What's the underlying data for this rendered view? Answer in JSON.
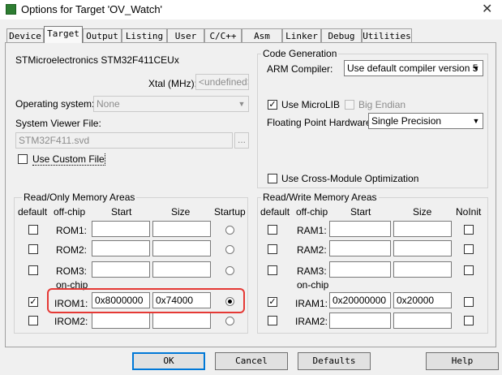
{
  "window": {
    "title": "Options for Target 'OV_Watch'",
    "close": "✕"
  },
  "tabs": [
    "Device",
    "Target",
    "Output",
    "Listing",
    "User",
    "C/C++",
    "Asm",
    "Linker",
    "Debug",
    "Utilities"
  ],
  "active_tab": "Target",
  "device": {
    "name": "STMicroelectronics STM32F411CEUx",
    "xtal_label": "Xtal (MHz):",
    "xtal_value": "<undefined>",
    "os_label": "Operating system:",
    "os_value": "None",
    "svd_label": "System Viewer File:",
    "svd_value": "STM32F411.svd",
    "browse": "...",
    "custom_file_label": "Use Custom File"
  },
  "codegen": {
    "title": "Code Generation",
    "compiler_label": "ARM Compiler:",
    "compiler_value": "Use default compiler version 5",
    "microlib_label": "Use MicroLIB",
    "big_endian_label": "Big Endian",
    "fp_label": "Floating Point Hardware:",
    "fp_value": "Single Precision",
    "cross_module_label": "Use Cross-Module Optimization"
  },
  "rom": {
    "title": "Read/Only Memory Areas",
    "headers": {
      "default": "default",
      "offchip": "off-chip",
      "start": "Start",
      "size": "Size",
      "startup": "Startup"
    },
    "onchip_label": "on-chip",
    "rows": [
      {
        "name": "ROM1:",
        "start": "",
        "size": ""
      },
      {
        "name": "ROM2:",
        "start": "",
        "size": ""
      },
      {
        "name": "ROM3:",
        "start": "",
        "size": ""
      },
      {
        "name": "IROM1:",
        "start": "0x8000000",
        "size": "0x74000"
      },
      {
        "name": "IROM2:",
        "start": "",
        "size": ""
      }
    ]
  },
  "ram": {
    "title": "Read/Write Memory Areas",
    "headers": {
      "default": "default",
      "offchip": "off-chip",
      "start": "Start",
      "size": "Size",
      "noinit": "NoInit"
    },
    "onchip_label": "on-chip",
    "rows": [
      {
        "name": "RAM1:",
        "start": "",
        "size": ""
      },
      {
        "name": "RAM2:",
        "start": "",
        "size": ""
      },
      {
        "name": "RAM3:",
        "start": "",
        "size": ""
      },
      {
        "name": "IRAM1:",
        "start": "0x20000000",
        "size": "0x20000"
      },
      {
        "name": "IRAM2:",
        "start": "",
        "size": ""
      }
    ]
  },
  "buttons": {
    "ok": "OK",
    "cancel": "Cancel",
    "defaults": "Defaults",
    "help": "Help"
  },
  "colors": {
    "highlight": "#e53935",
    "focus": "#0078d7"
  }
}
